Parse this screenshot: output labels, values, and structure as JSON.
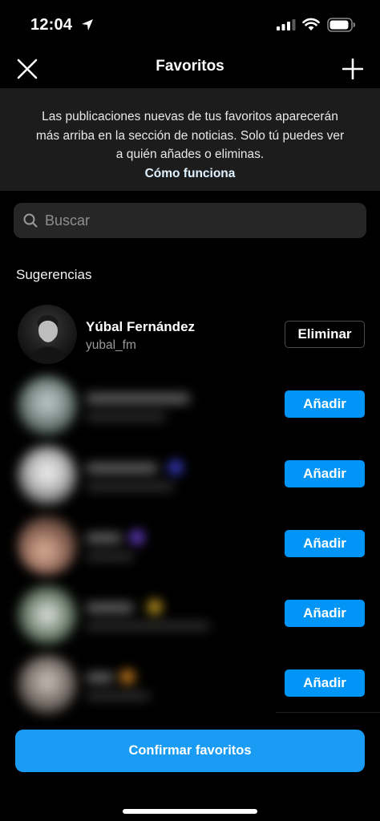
{
  "status_bar": {
    "time": "12:04",
    "icons": [
      "location-arrow-icon",
      "signal-bars-icon",
      "wifi-icon",
      "battery-icon"
    ]
  },
  "header": {
    "title": "Favoritos",
    "left_icon": "close-icon",
    "right_icon": "plus-icon"
  },
  "info": {
    "text": "Las publicaciones nuevas de tus favoritos aparecerán más arriba en la sección de noticias. Solo tú puedes ver a quién añades o eliminas.",
    "link": "Cómo funciona"
  },
  "search": {
    "placeholder": "Buscar",
    "value": ""
  },
  "suggestions": {
    "title": "Sugerencias",
    "featured": {
      "name": "Yúbal Fernández",
      "handle": "yubal_fm",
      "button": "Eliminar"
    },
    "others": [
      {
        "button": "Añadir",
        "blurred": true
      },
      {
        "button": "Añadir",
        "blurred": true
      },
      {
        "button": "Añadir",
        "blurred": true
      },
      {
        "button": "Añadir",
        "blurred": true
      },
      {
        "button": "Añadir",
        "blurred": true
      }
    ]
  },
  "confirm_button": "Confirmar favoritos",
  "colors": {
    "background": "#000000",
    "banner": "#1c1c1c",
    "accent": "#0095f6",
    "search_bg": "#262626"
  }
}
